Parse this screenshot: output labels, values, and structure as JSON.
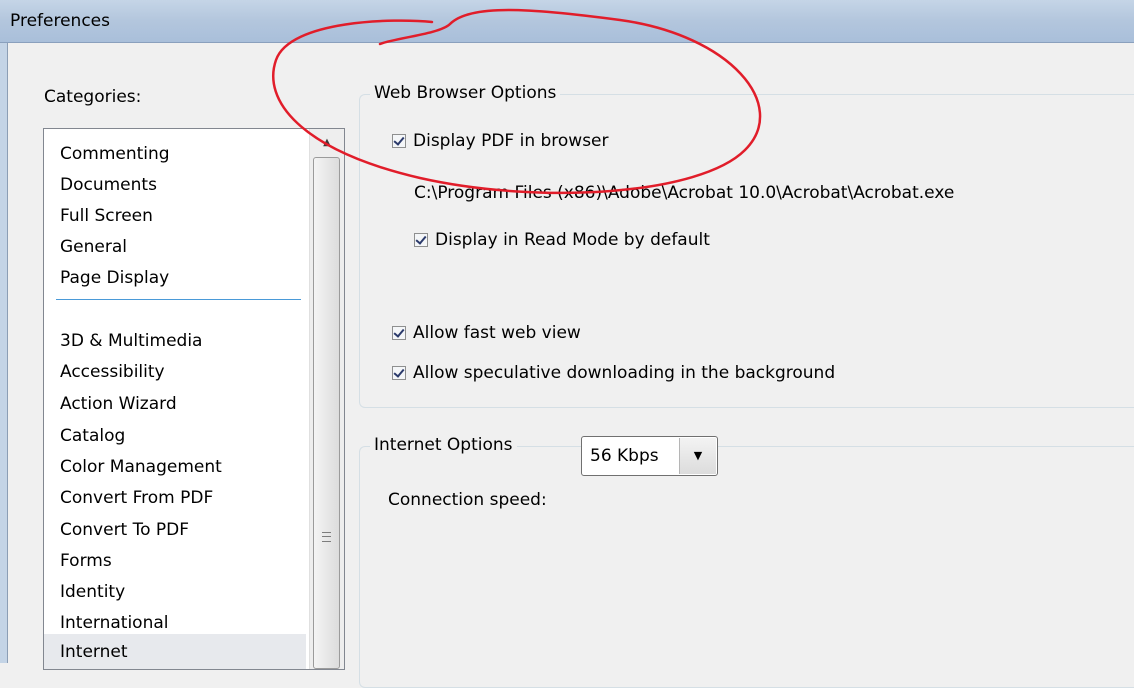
{
  "window": {
    "title": "Preferences"
  },
  "categories": {
    "label": "Categories:",
    "items": [
      "Commenting",
      "Documents",
      "Full Screen",
      "General",
      "Page Display",
      "3D & Multimedia",
      "Accessibility",
      "Action Wizard",
      "Catalog",
      "Color Management",
      "Convert From PDF",
      "Convert To PDF",
      "Forms",
      "Identity",
      "International",
      "Internet"
    ],
    "selected": "Internet"
  },
  "web_browser_options": {
    "title": "Web Browser Options",
    "display_pdf": {
      "label": "Display PDF in browser",
      "checked": true
    },
    "path": "C:\\Program Files (x86)\\Adobe\\Acrobat 10.0\\Acrobat\\Acrobat.exe",
    "read_mode": {
      "label": "Display in Read Mode by default",
      "checked": true
    },
    "fast_web_view": {
      "label": "Allow fast web view",
      "checked": true
    },
    "speculative": {
      "label": "Allow speculative downloading in the background",
      "checked": true
    }
  },
  "internet_options": {
    "title": "Internet Options",
    "connection_speed_label": "Connection speed:",
    "connection_speed_value": "56 Kbps"
  },
  "colors": {
    "annotation": "#e11d2a",
    "selection_separator": "#4a9ad8"
  },
  "icons": {
    "scroll_up": "▲",
    "dropdown": "▼"
  }
}
